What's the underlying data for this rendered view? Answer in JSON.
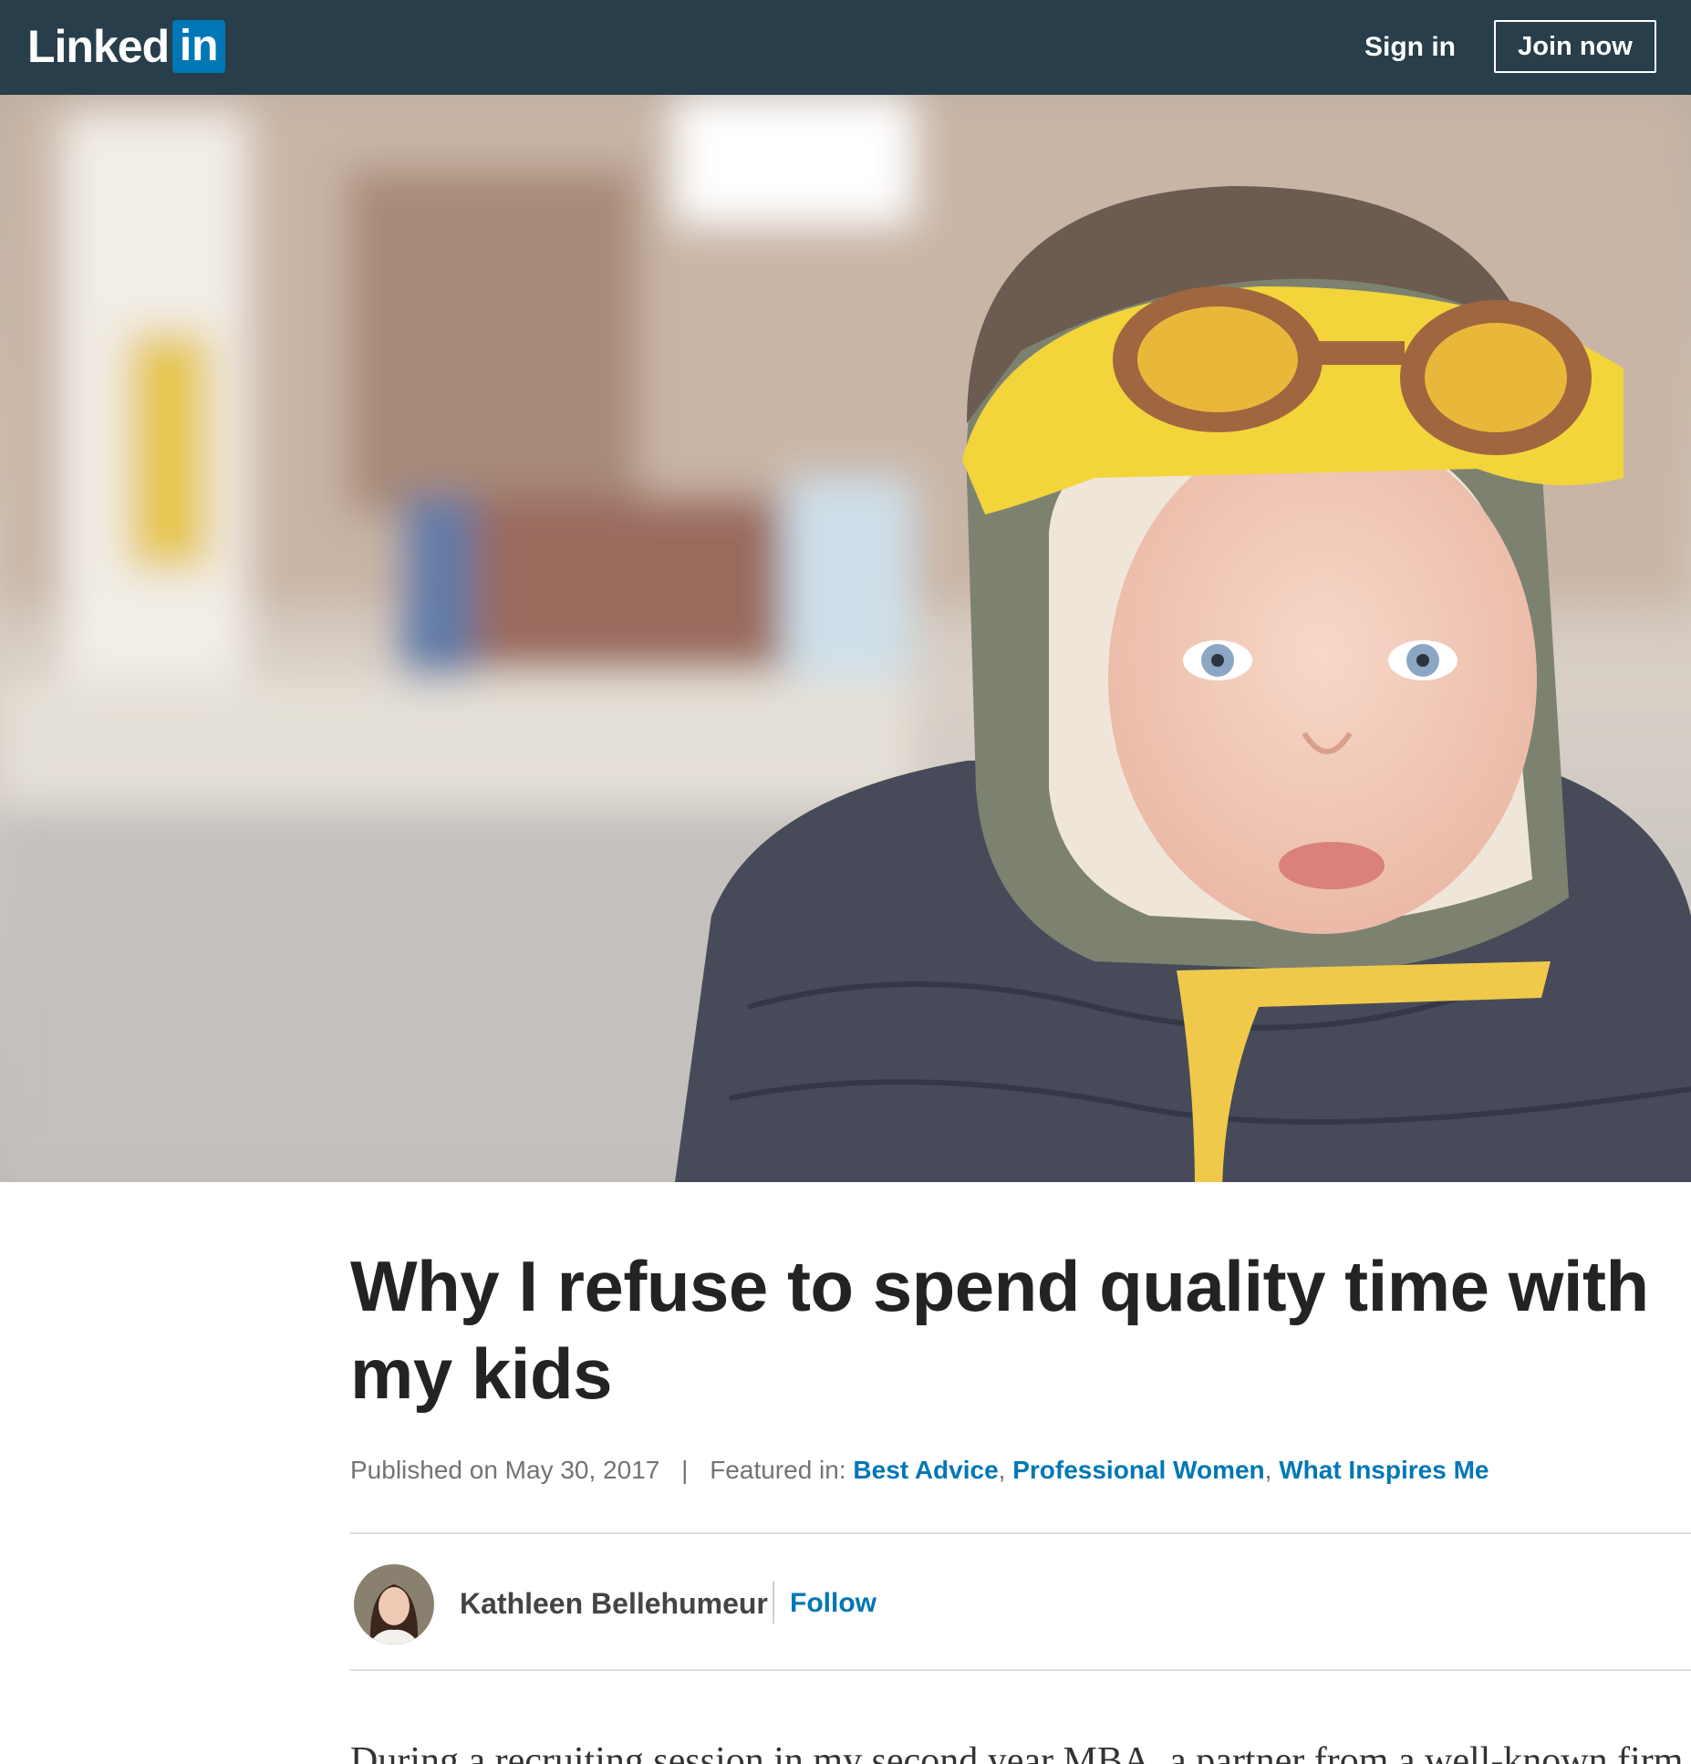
{
  "header": {
    "logo_text": "Linked",
    "logo_box_text": "in",
    "sign_in": "Sign in",
    "join_now": "Join now",
    "colors": {
      "bar": "#283e4a",
      "brand": "#0077b5"
    }
  },
  "article": {
    "title": "Why I refuse to spend quality time with my kids",
    "published": "Published on May 30, 2017",
    "separator": "|",
    "featured_label": "Featured in:",
    "featured_tags": [
      "Best Advice",
      "Professional Women",
      "What Inspires Me"
    ],
    "tag_comma": ",",
    "author": "Kathleen Bellehumeur",
    "follow": "Follow",
    "body_first_line": "During a recruiting session in my second year MBA, a partner from a well-known firm"
  }
}
